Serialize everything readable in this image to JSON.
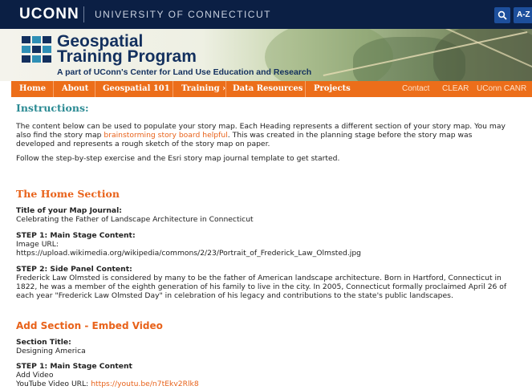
{
  "topbar": {
    "brand": "UCONN",
    "university": "UNIVERSITY OF CONNECTICUT",
    "az": "A-Z"
  },
  "banner": {
    "title_line1": "Geospatial",
    "title_line2": "Training Program",
    "subtitle": "A part of UConn's Center for Land Use Education and Research"
  },
  "nav": {
    "items": [
      "Home",
      "About",
      "Geospatial 101",
      "Training ›",
      "Data Resources",
      "Projects"
    ],
    "right": [
      "Contact",
      "CLEAR",
      "UConn CANR"
    ]
  },
  "content": {
    "instructions_heading": "Instructions:",
    "intro_line1": "The content below can be used to populate your story map. Each Heading represents a different section of your story map. You may",
    "intro_line2_pre": "also find the story map ",
    "intro_link": "brainstorming story board helpful",
    "intro_line2_post": ". This was created in the planning stage before the story map was",
    "intro_line3": "developed and represents a rough sketch of the story map on paper.",
    "follow": "Follow the step-by-step exercise and the Esri story map journal template to get started.",
    "home_heading": "The Home Section",
    "journal_title_label": "Title of your Map Journal:",
    "journal_title_value": "Celebrating the Father of Landscape Architecture in Connecticut",
    "step1_label": "STEP 1: Main Stage Content:",
    "step1_line1": "Image URL:",
    "step1_line2": "https://upload.wikimedia.org/wikipedia/commons/2/23/Portrait_of_Frederick_Law_Olmsted.jpg",
    "step2_label": "STEP 2: Side Panel Content:",
    "step2_line1": "Frederick Law Olmsted is considered by many to be the father of American landscape architecture. Born in Hartford, Connecticut in",
    "step2_line2": "1822, he was a member of the eighth generation of his family to live in the city. In 2005, Connecticut formally proclaimed April 26 of",
    "step2_line3": "each year \"Frederick Law Olmsted Day\" in celebration of his legacy and contributions to the state's public landscapes.",
    "video_heading": "Add Section - Embed Video",
    "section_title_label": "Section Title:",
    "section_title_value": "Designing America",
    "video_step1_label": "STEP 1: Main Stage Content",
    "video_step1_line1": "Add Video",
    "video_url_label": "YouTube Video URL: ",
    "video_url": "https://youtu.be/n7tEkv2Rlk8"
  },
  "colors": {
    "topbar": "#0b1f44",
    "nav": "#ec6e1a",
    "heading_teal": "#2a8a93",
    "heading_orange": "#e8621a"
  }
}
